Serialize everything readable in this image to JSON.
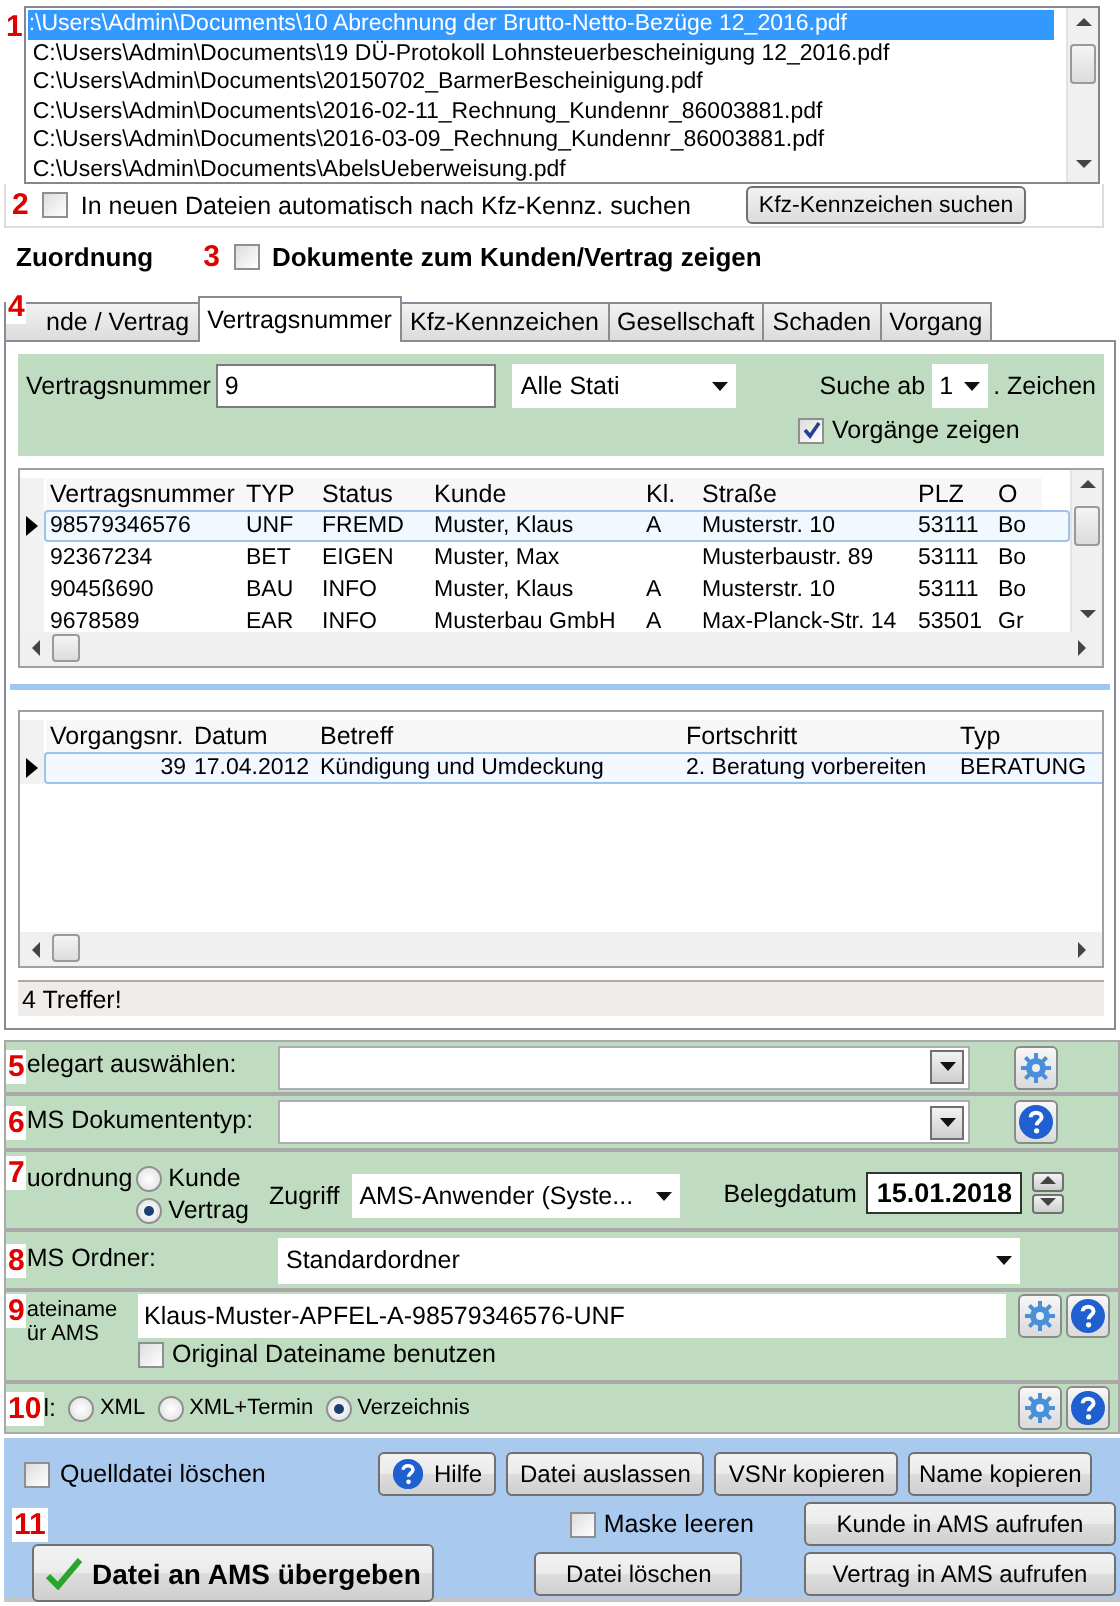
{
  "file_list": {
    "marker": "1",
    "items": [
      {
        "text": ":\\Users\\Admin\\Documents\\10 Abrechnung der Brutto-Netto-Bezüge  12_2016.pdf",
        "selected": true
      },
      {
        "text": "C:\\Users\\Admin\\Documents\\19 DÜ-Protokoll Lohnsteuerbescheinigung 12_2016.pdf",
        "selected": false
      },
      {
        "text": "C:\\Users\\Admin\\Documents\\20150702_BarmerBescheinigung.pdf",
        "selected": false
      },
      {
        "text": "C:\\Users\\Admin\\Documents\\2016-02-11_Rechnung_Kundennr_86003881.pdf",
        "selected": false
      },
      {
        "text": "C:\\Users\\Admin\\Documents\\2016-03-09_Rechnung_Kundennr_86003881.pdf",
        "selected": false
      },
      {
        "text": "C:\\Users\\Admin\\Documents\\AbelsUeberweisung.pdf",
        "selected": false
      }
    ]
  },
  "auto_search": {
    "marker": "2",
    "label": "In neuen Dateien automatisch nach Kfz-Kennz. suchen",
    "checked": false,
    "button": "Kfz-Kennzeichen suchen"
  },
  "assignment": {
    "title": "Zuordnung",
    "marker": "3",
    "label": "Dokumente zum Kunden/Vertrag zeigen",
    "checked": false
  },
  "tabs": {
    "marker": "4",
    "items": [
      {
        "label": "nde / Vertrag",
        "selected": false
      },
      {
        "label": "Vertragsnummer",
        "selected": true
      },
      {
        "label": "Kfz-Kennzeichen",
        "selected": false
      },
      {
        "label": "Gesellschaft",
        "selected": false
      },
      {
        "label": "Schaden",
        "selected": false
      },
      {
        "label": "Vorgang",
        "selected": false
      }
    ]
  },
  "filter": {
    "label": "Vertragsnummer",
    "value": "9",
    "status": "Alle Stati",
    "search_from_label": "Suche ab",
    "search_from": "1",
    "search_from_suffix": ". Zeichen",
    "show_cases": {
      "label": "Vorgänge zeigen",
      "checked": true
    }
  },
  "contracts": {
    "columns": [
      "Vertragsnummer",
      "TYP",
      "Status",
      "Kunde",
      "Kl.",
      "Straße",
      "PLZ",
      "O"
    ],
    "rows": [
      {
        "cells": [
          "98579346576",
          "UNF",
          "FREMD",
          "Muster, Klaus",
          "A",
          "Musterstr. 10",
          "53111",
          "Bo"
        ],
        "selected": true
      },
      {
        "cells": [
          "92367234",
          "BET",
          "EIGEN",
          "Muster, Max",
          "",
          "Musterbaustr. 89",
          "53111",
          "Bo"
        ],
        "selected": false
      },
      {
        "cells": [
          "9045ß690",
          "BAU",
          "INFO",
          "Muster, Klaus",
          "A",
          "Musterstr. 10",
          "53111",
          "Bo"
        ],
        "selected": false
      },
      {
        "cells": [
          "9678589",
          "EAR",
          "INFO",
          "Musterbau GmbH",
          "A",
          "Max-Planck-Str. 14",
          "53501",
          "Gr"
        ],
        "selected": false
      }
    ]
  },
  "cases": {
    "columns": [
      "Vorgangsnr.",
      "Datum",
      "Betreff",
      "Fortschritt",
      "Typ"
    ],
    "rows": [
      {
        "cells": [
          "39",
          "17.04.2012",
          "Kündigung und Umdeckung",
          "2. Beratung vorbereiten",
          "BERATUNG"
        ],
        "selected": true
      }
    ]
  },
  "status_bar": "4 Treffer!",
  "document_type": {
    "marker": "5",
    "label": "elegart auswählen:"
  },
  "ams_doc_type": {
    "marker": "6",
    "label": "MS Dokumententyp:"
  },
  "zuordnung": {
    "marker": "7",
    "label": "uordnung",
    "options": [
      {
        "label": "Kunde",
        "selected": false
      },
      {
        "label": "Vertrag",
        "selected": true
      }
    ],
    "access_label": "Zugriff",
    "access": "AMS-Anwender (Syste...",
    "date_label": "Belegdatum",
    "date": "15.01.2018"
  },
  "folder": {
    "marker": "8",
    "label": "MS Ordner:",
    "value": "Standardordner"
  },
  "filename": {
    "marker": "9",
    "label_lines": [
      "ateiname",
      "ür AMS"
    ],
    "value": "Klaus-Muster-APFEL-A-98579346576-UNF",
    "use_original": {
      "label": "Original Dateiname benutzen",
      "checked": false
    }
  },
  "output": {
    "marker": "10",
    "label": "l:",
    "options": [
      {
        "label": "XML",
        "selected": false
      },
      {
        "label": "XML+Termin",
        "selected": false
      },
      {
        "label": "Verzeichnis",
        "selected": true
      }
    ]
  },
  "actions": {
    "marker": "11",
    "delete_source": {
      "label": "Quelldatei löschen",
      "checked": false
    },
    "clear_mask": {
      "label": "Maske leeren",
      "checked": false
    },
    "help": "Hilfe",
    "skip": "Datei auslassen",
    "copy_vsnr": "VSNr kopieren",
    "copy_name": "Name kopieren",
    "open_customer": "Kunde in AMS aufrufen",
    "delete_file": "Datei löschen",
    "open_contract": "Vertrag in AMS aufrufen",
    "submit": "Datei an AMS übergeben"
  }
}
